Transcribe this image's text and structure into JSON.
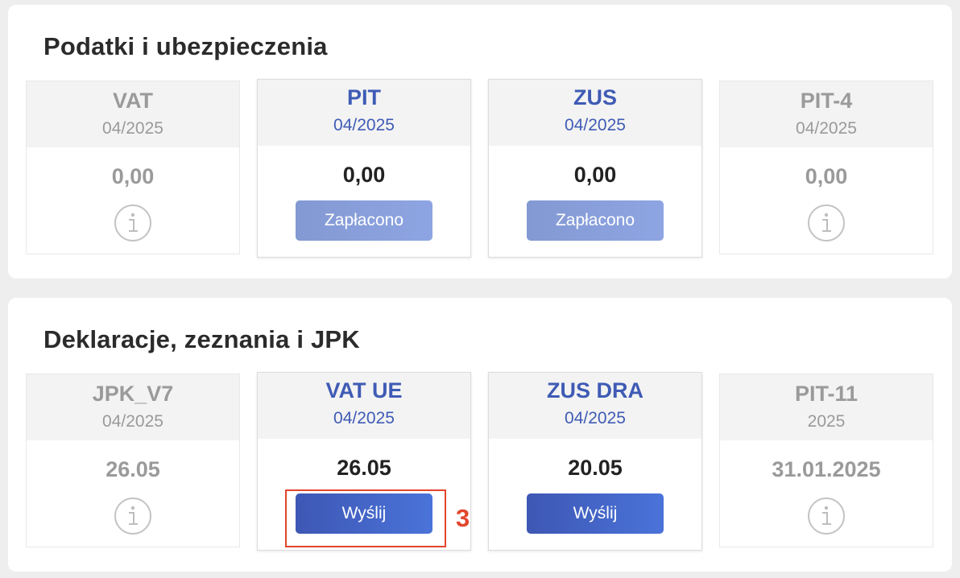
{
  "taxes": {
    "title": "Podatki i ubezpieczenia",
    "cards": [
      {
        "name": "VAT",
        "period": "04/2025",
        "amount": "0,00",
        "action": "info"
      },
      {
        "name": "PIT",
        "period": "04/2025",
        "amount": "0,00",
        "button": "Zapłacono"
      },
      {
        "name": "ZUS",
        "period": "04/2025",
        "amount": "0,00",
        "button": "Zapłacono"
      },
      {
        "name": "PIT-4",
        "period": "04/2025",
        "amount": "0,00",
        "action": "info"
      }
    ]
  },
  "declarations": {
    "title": "Deklaracje, zeznania i JPK",
    "cards": [
      {
        "name": "JPK_V7",
        "period": "04/2025",
        "amount": "26.05",
        "action": "info"
      },
      {
        "name": "VAT UE",
        "period": "04/2025",
        "amount": "26.05",
        "button": "Wyślij"
      },
      {
        "name": "ZUS DRA",
        "period": "04/2025",
        "amount": "20.05",
        "button": "Wyślij"
      },
      {
        "name": "PIT-11",
        "period": "2025",
        "amount": "31.01.2025",
        "action": "info"
      }
    ]
  },
  "annotation": {
    "number": "3",
    "color": "#e2462d"
  },
  "colors": {
    "accent": "#3f5bb5",
    "muted": "#9a9a9a",
    "paid_button": "#8a9fdc",
    "send_button": "#4565c6"
  },
  "icons": {
    "info": "info-circle-icon"
  }
}
